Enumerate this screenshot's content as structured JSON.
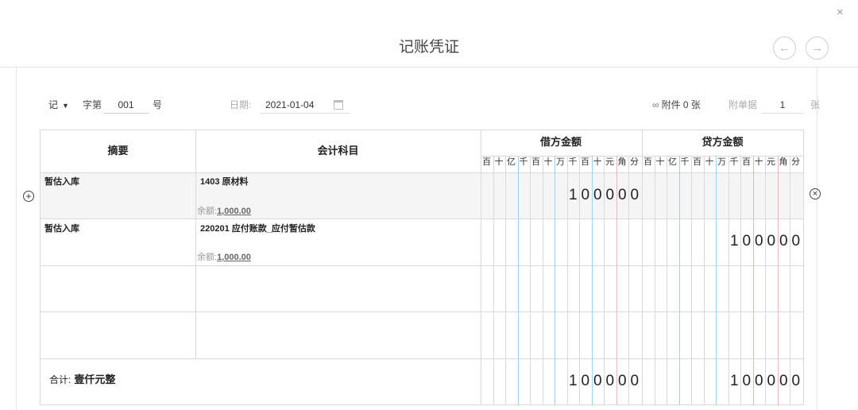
{
  "dialog": {
    "title": "记账凭证",
    "close_glyph": "×",
    "prev_glyph": "←",
    "next_glyph": "→"
  },
  "voucher_meta": {
    "word": "记",
    "word_caret": "▼",
    "zi_label": "字第",
    "number": "001",
    "hao_label": "号",
    "date_label": "日期:",
    "date": "2021-01-04",
    "attachment": "附件 0 张",
    "fudan_label": "附单据",
    "fudan_count": "1",
    "zhang_label": "张"
  },
  "table": {
    "col_summary": "摘要",
    "col_account": "会计科目",
    "col_debit": "借方金额",
    "col_credit": "贷方金额",
    "digit_headers": [
      "百",
      "十",
      "亿",
      "千",
      "百",
      "十",
      "万",
      "千",
      "百",
      "十",
      "元",
      "角",
      "分"
    ],
    "rows": [
      {
        "summary": "暂估入库",
        "account": "1403 原材料",
        "balance_label": "余额:",
        "balance": "1,000.00",
        "debit": "100000",
        "credit": ""
      },
      {
        "summary": "暂估入库",
        "account": "220201 应付账款_应付暂估款",
        "balance_label": "余额:",
        "balance": "1,000.00",
        "debit": "",
        "credit": "100000"
      },
      {
        "summary": "",
        "account": "",
        "debit": "",
        "credit": ""
      },
      {
        "summary": "",
        "account": "",
        "debit": "",
        "credit": ""
      }
    ],
    "total_label": "合计:",
    "total_words": "壹仟元整",
    "total_debit": "100000",
    "total_credit": "100000"
  },
  "row_controls": {
    "add_glyph": "+",
    "delete_glyph": "×"
  },
  "colors": {
    "blue_guide": "#9fd0ee",
    "red_guide": "#f0b3b3",
    "grid": "#d9d9d9"
  }
}
